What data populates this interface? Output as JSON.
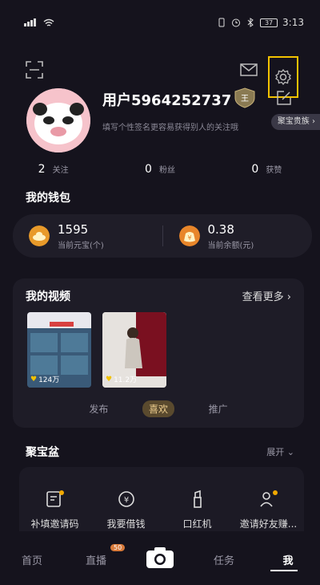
{
  "status_bar": {
    "time": "3:13",
    "battery": "37"
  },
  "profile": {
    "username": "用户5964252737",
    "signature": "填写个性签名更容易获得别人的关注哦",
    "jubao_tag": "聚宝贵族"
  },
  "stats": [
    {
      "num": "2",
      "label": "关注"
    },
    {
      "num": "0",
      "label": "粉丝"
    },
    {
      "num": "0",
      "label": "获赞"
    }
  ],
  "wallet": {
    "title": "我的钱包",
    "coins_value": "1595",
    "coins_label": "当前元宝(个)",
    "balance_value": "0.38",
    "balance_label": "当前余额(元)"
  },
  "videos": {
    "title": "我的视频",
    "see_more": "查看更多",
    "items": [
      {
        "likes": "124万"
      },
      {
        "likes": "11.2万"
      }
    ],
    "tabs": [
      "发布",
      "喜欢",
      "推广"
    ],
    "active_tab": "喜欢"
  },
  "jubao": {
    "title": "聚宝盆",
    "expand": "展开",
    "items": [
      {
        "label": "补填邀请码",
        "icon": "invite-code-icon"
      },
      {
        "label": "我要借钱",
        "icon": "loan-icon"
      },
      {
        "label": "口红机",
        "icon": "lipstick-icon"
      },
      {
        "label": "邀请好友赚...",
        "icon": "invite-friends-icon"
      }
    ]
  },
  "tabbar": {
    "home": "首页",
    "live": "直播",
    "live_badge": "50",
    "tasks": "任务",
    "me": "我"
  },
  "colors": {
    "background": "#15131d",
    "card": "#1f1d28",
    "highlight": "#f2c200",
    "active_tab_bg": "#5a4a2e"
  }
}
